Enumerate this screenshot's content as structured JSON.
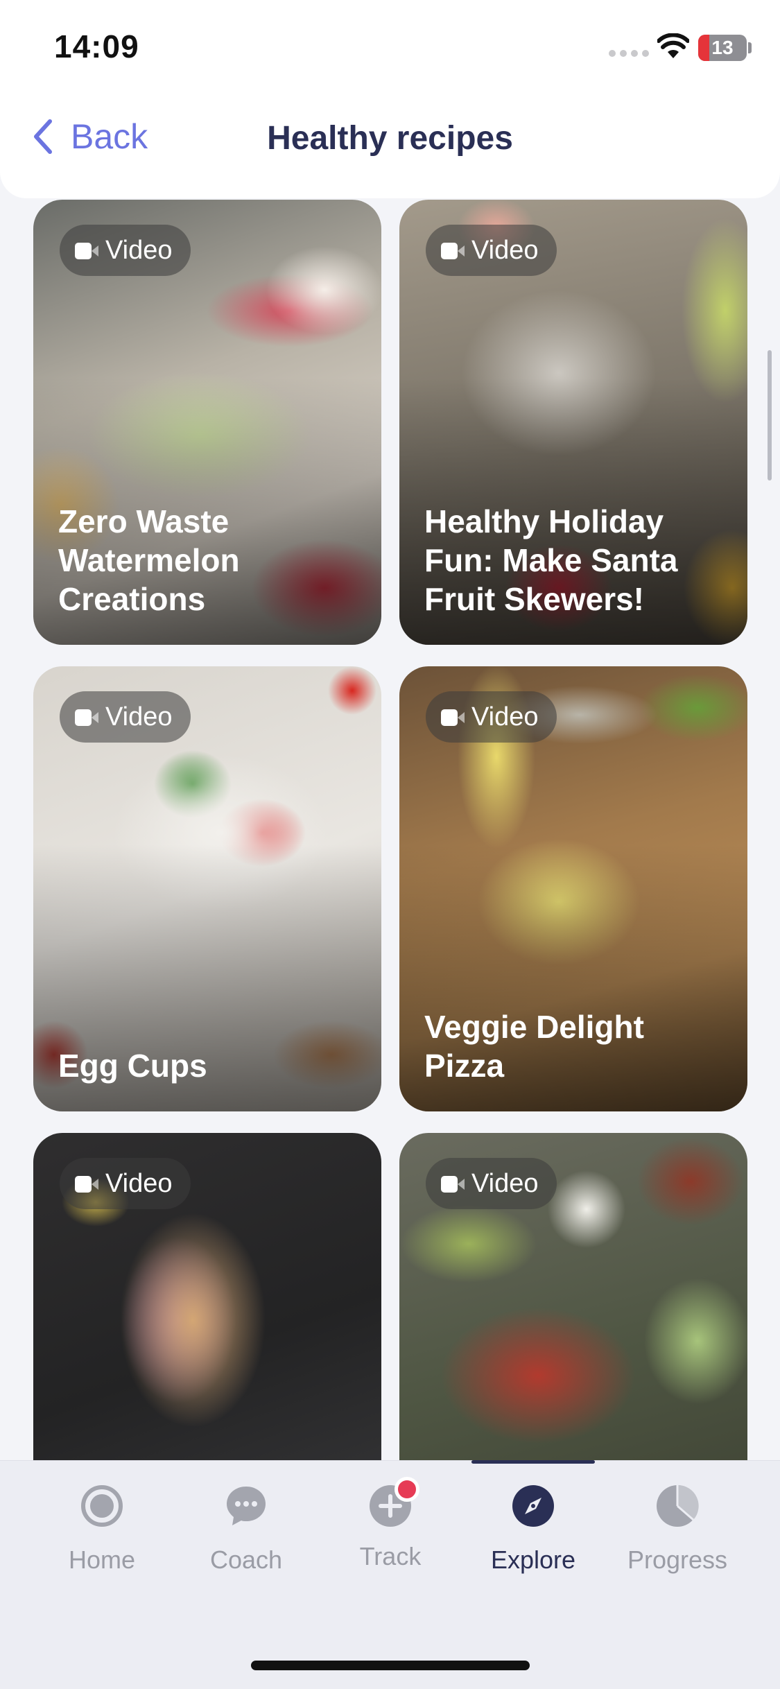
{
  "status_bar": {
    "time": "14:09",
    "battery": "13",
    "icons": [
      "signal-icon",
      "wifi-icon",
      "battery-icon"
    ]
  },
  "header": {
    "back_label": "Back",
    "title": "Healthy recipes"
  },
  "recipes": [
    {
      "badge": "Video",
      "title": "Zero Waste Watermelon Creations"
    },
    {
      "badge": "Video",
      "title": "Healthy Holiday Fun: Make Santa Fruit Skewers!"
    },
    {
      "badge": "Video",
      "title": "Egg Cups"
    },
    {
      "badge": "Video",
      "title": "Veggie Delight Pizza"
    },
    {
      "badge": "Video",
      "title": ""
    },
    {
      "badge": "Video",
      "title": ""
    }
  ],
  "tabbar": {
    "active": "Explore",
    "items": [
      {
        "label": "Home",
        "icon": "home-icon"
      },
      {
        "label": "Coach",
        "icon": "chat-icon"
      },
      {
        "label": "Track",
        "icon": "plus-icon",
        "has_notification": true
      },
      {
        "label": "Explore",
        "icon": "compass-icon"
      },
      {
        "label": "Progress",
        "icon": "pie-chart-icon"
      }
    ]
  },
  "colors": {
    "accent": "#6b74e0",
    "title": "#2a2f55",
    "inactive": "#9a9ca5",
    "notification": "#e63b55"
  }
}
